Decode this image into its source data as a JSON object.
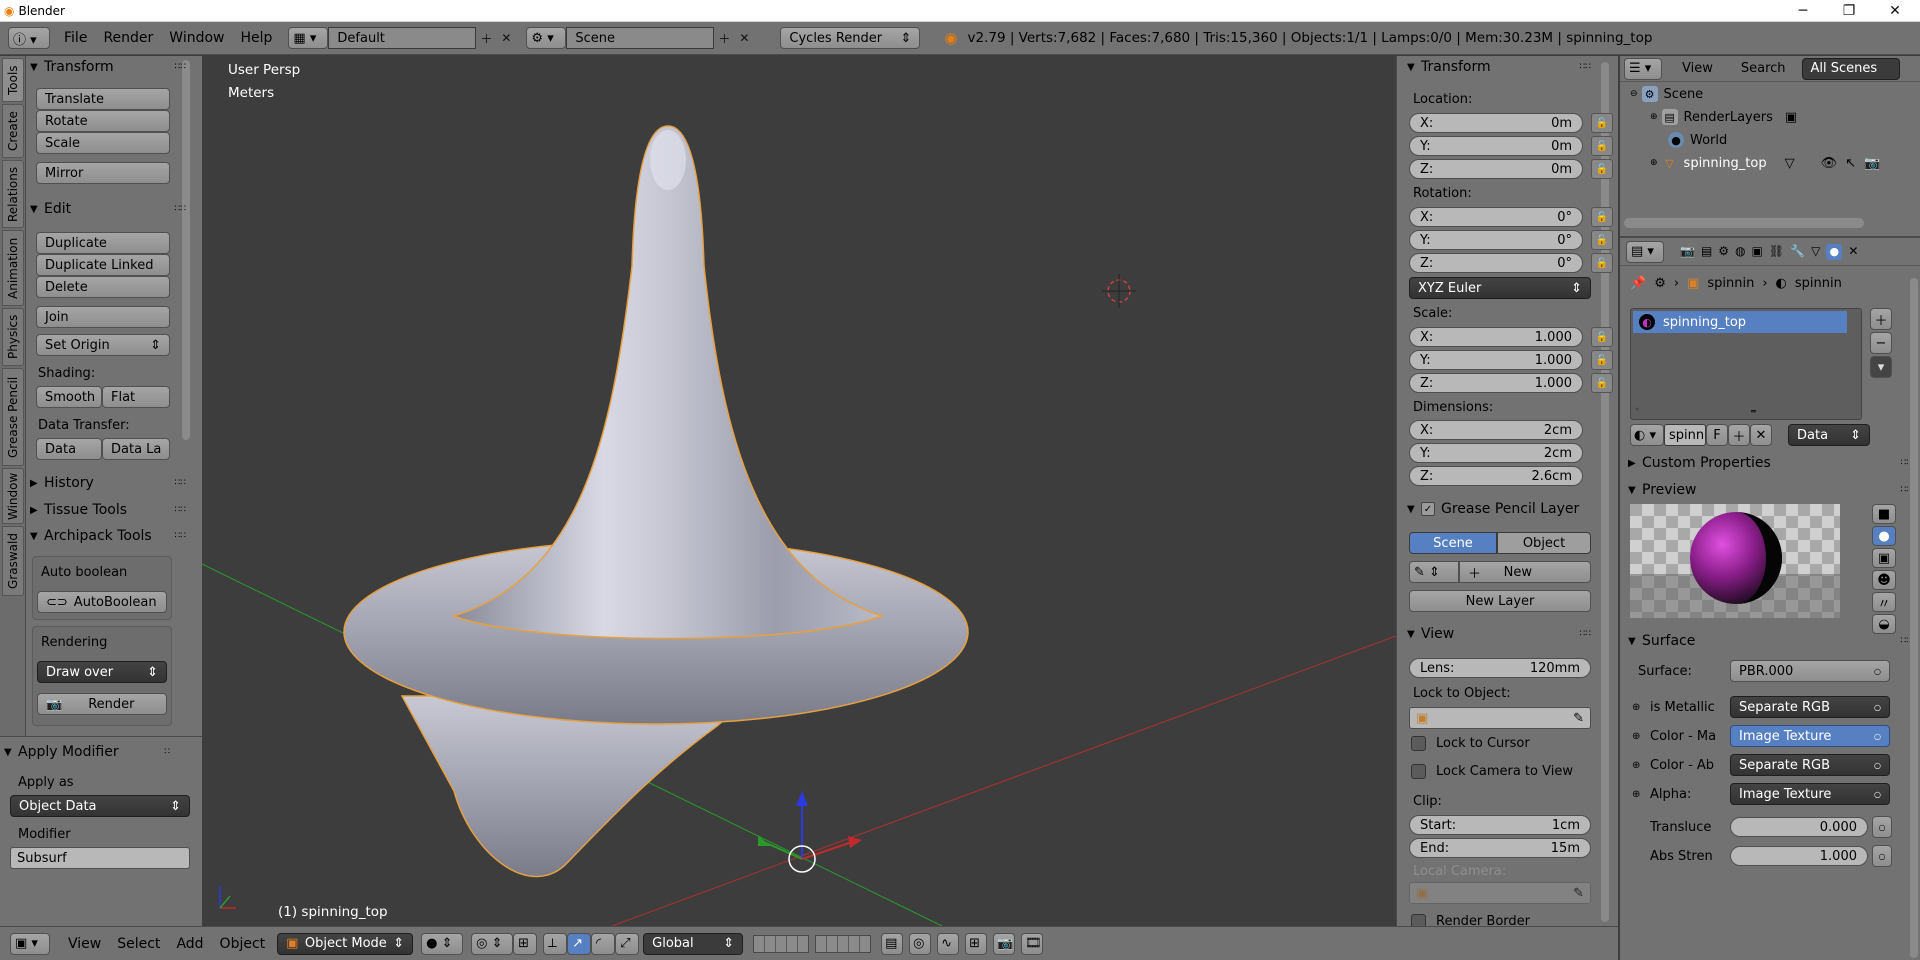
{
  "window": {
    "title": "Blender",
    "minimize": "─",
    "maximize": "❐",
    "close": "✕"
  },
  "menubar": {
    "menus": [
      "File",
      "Render",
      "Window",
      "Help"
    ],
    "layout": "Default",
    "scene": "Scene",
    "engine": "Cycles Render",
    "stats": "v2.79 | Verts:7,682 | Faces:7,680 | Tris:15,360 | Objects:1/1 | Lamps:0/0 | Mem:30.23M | spinning_top"
  },
  "lefttabs": [
    "Tools",
    "Create",
    "Relations",
    "Animation",
    "Physics",
    "Grease Pencil",
    "Window",
    "Graswald"
  ],
  "toolshelf": {
    "transform": {
      "title": "Transform",
      "buttons": [
        "Translate",
        "Rotate",
        "Scale",
        "Mirror"
      ]
    },
    "edit": {
      "title": "Edit",
      "buttons": [
        "Duplicate",
        "Duplicate Linked",
        "Delete",
        "Join"
      ],
      "set_origin": "Set Origin",
      "shading_label": "Shading:",
      "smooth": "Smooth",
      "flat": "Flat",
      "data_transfer_label": "Data Transfer:",
      "data": "Data",
      "data_la": "Data La"
    },
    "history": "History",
    "tissue": "Tissue Tools",
    "archipack": {
      "title": "Archipack Tools",
      "auto_boolean_label": "Auto boolean",
      "auto_boolean_btn": "AutoBoolean",
      "rendering_label": "Rendering",
      "draw_over": "Draw over",
      "render_btn": "Render"
    }
  },
  "opshelf": {
    "title": "Apply Modifier",
    "apply_as_label": "Apply as",
    "apply_as": "Object Data",
    "modifier_label": "Modifier",
    "modifier": "Subsurf"
  },
  "viewport": {
    "view_name": "User Persp",
    "units": "Meters",
    "object_label": "(1) spinning_top"
  },
  "npanel": {
    "transform_title": "Transform",
    "location_label": "Location:",
    "location": [
      {
        "axis": "X:",
        "value": "0m"
      },
      {
        "axis": "Y:",
        "value": "0m"
      },
      {
        "axis": "Z:",
        "value": "0m"
      }
    ],
    "rotation_label": "Rotation:",
    "rotation": [
      {
        "axis": "X:",
        "value": "0°"
      },
      {
        "axis": "Y:",
        "value": "0°"
      },
      {
        "axis": "Z:",
        "value": "0°"
      }
    ],
    "rotation_mode": "XYZ Euler",
    "scale_label": "Scale:",
    "scale": [
      {
        "axis": "X:",
        "value": "1.000"
      },
      {
        "axis": "Y:",
        "value": "1.000"
      },
      {
        "axis": "Z:",
        "value": "1.000"
      }
    ],
    "dimensions_label": "Dimensions:",
    "dimensions": [
      {
        "axis": "X:",
        "value": "2cm"
      },
      {
        "axis": "Y:",
        "value": "2cm"
      },
      {
        "axis": "Z:",
        "value": "2.6cm"
      }
    ],
    "gp_title": "Grease Pencil Layer",
    "gp_scene": "Scene",
    "gp_object": "Object",
    "gp_new": "New",
    "gp_new_layer": "New Layer",
    "view_title": "View",
    "lens_label": "Lens:",
    "lens": "120mm",
    "lock_obj_label": "Lock to Object:",
    "lock_cursor": "Lock to Cursor",
    "lock_camera": "Lock Camera to View",
    "clip_label": "Clip:",
    "clip_start_label": "Start:",
    "clip_start": "1cm",
    "clip_end_label": "End:",
    "clip_end": "15m",
    "local_camera_label": "Local Camera:",
    "render_border": "Render Border"
  },
  "outliner": {
    "view": "View",
    "search": "Search",
    "all_scenes": "All Scenes",
    "items": [
      "Scene",
      "RenderLayers",
      "World",
      "spinning_top"
    ]
  },
  "props": {
    "breadcrumb1": "spinnin",
    "breadcrumb2": "spinnin",
    "material": "spinning_top",
    "mat_name": "spinni",
    "mat_f": "F",
    "data_dd": "Data",
    "custom_props": "Custom Properties",
    "preview": "Preview",
    "surface_title": "Surface",
    "surface_label": "Surface:",
    "surface_value": "PBR.000",
    "rows": [
      {
        "label": "is Metallic",
        "value": "Separate RGB"
      },
      {
        "label": "Color - Ma",
        "value": "Image Texture"
      },
      {
        "label": "Color - Ab",
        "value": "Separate RGB"
      },
      {
        "label": "Alpha:",
        "value": "Image Texture"
      }
    ],
    "translu_label": "Transluce",
    "translu_value": "0.000",
    "abs_label": "Abs Stren",
    "abs_value": "1.000"
  },
  "bottombar": {
    "view": "View",
    "select": "Select",
    "add": "Add",
    "object": "Object",
    "mode": "Object Mode",
    "orientation": "Global"
  },
  "colors": {
    "accent": "#5680c2",
    "panel": "#727272",
    "viewport": "#3d3d3d",
    "selected_outline": "#f0a040"
  }
}
